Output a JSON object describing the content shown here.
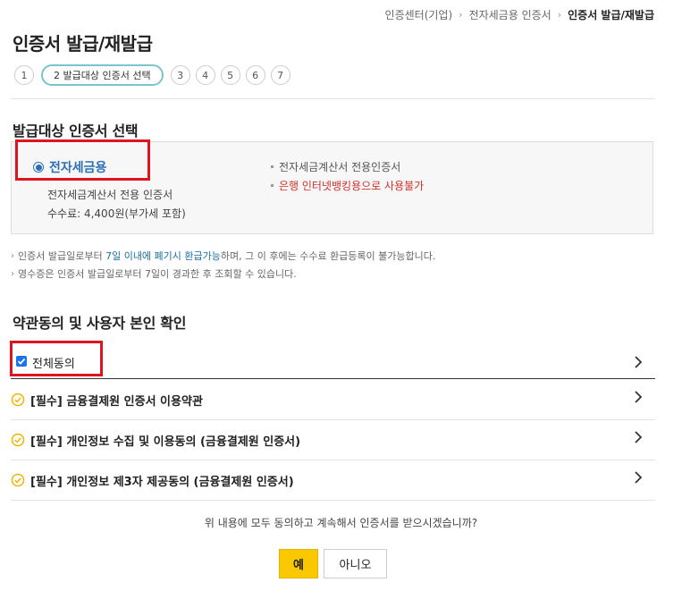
{
  "breadcrumb": {
    "items": [
      "인증센터(기업)",
      "전자세금용 인증서"
    ],
    "current": "인증서 발급/재발급"
  },
  "page_title": "인증서 발급/재발급",
  "steps": {
    "items": [
      "1",
      "2 발급대상 인증서 선택",
      "3",
      "4",
      "5",
      "6",
      "7"
    ],
    "active_index": 1
  },
  "cert_section": {
    "title": "발급대상 인증서 선택",
    "option_label": "전자세금용",
    "option_selected": true,
    "desc": "전자세금계산서 전용 인증서",
    "fee": "수수료: 4,400원(부가세 포함)",
    "note_1": "전자세금계산서 전용인증서",
    "note_2": "은행 인터넷뱅킹용으로 사용불가"
  },
  "notices": {
    "line1_a": "인증서 발급일로부터 ",
    "line1_hl": "7일 이내에 폐기시 환급가능",
    "line1_b": "하며, 그 이 후에는 수수료 환급등록이 불가능합니다.",
    "line2": "영수증은 인증서 발급일로부터 7일이 경과한 후 조회할 수 있습니다."
  },
  "agreement": {
    "title": "약관동의 및 사용자 본인 확인",
    "agree_all_label": "전체동의",
    "agree_all_checked": true,
    "terms": [
      "[필수] 금융결제원 인증서 이용약관",
      "[필수] 개인정보 수집 및 이용동의 (금융결제원 인증서)",
      "[필수] 개인정보 제3자 제공동의 (금융결제원 인증서)"
    ]
  },
  "confirm": {
    "question": "위 내용에 모두 동의하고 계속해서 인증서를 받으시겠습니까?",
    "yes_label": "예",
    "no_label": "아니오"
  },
  "colors": {
    "accent_blue": "#2a6fb5",
    "highlight_red": "#e0141e",
    "button_yellow": "#f9c800",
    "step_active_border": "#7cc4cc",
    "check_yellow": "#f2b400"
  }
}
